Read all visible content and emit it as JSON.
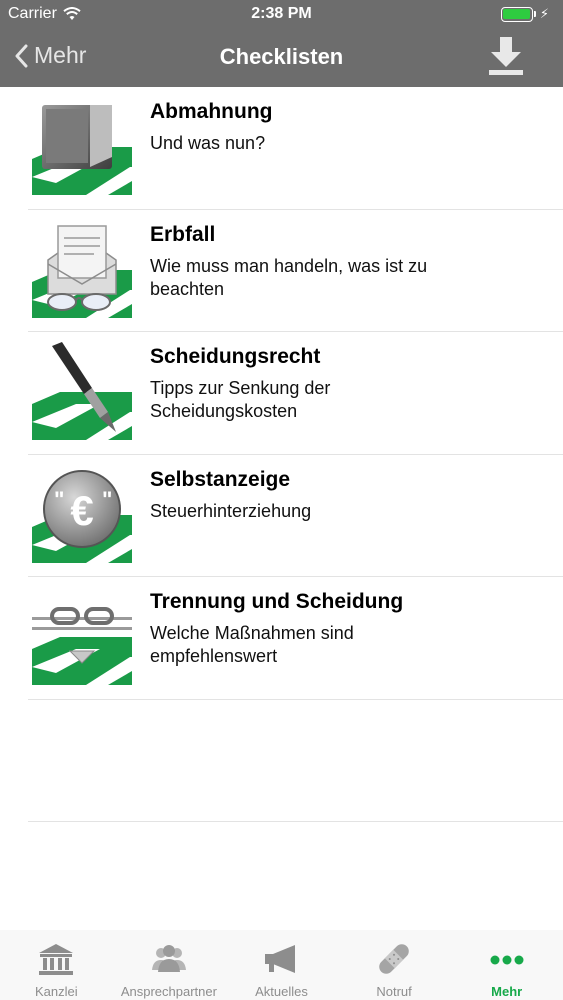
{
  "status_bar": {
    "carrier": "Carrier",
    "time": "2:38 PM",
    "battery_color": "#2ecc40"
  },
  "nav": {
    "back_label": "Mehr",
    "title": "Checklisten",
    "action_icon": "download-icon"
  },
  "checklists": [
    {
      "title": "Abmahnung",
      "subtitle": "Und was nun?",
      "icon": "wallet-icon"
    },
    {
      "title": "Erbfall",
      "subtitle": "Wie muss man handeln, was ist zu beachten",
      "icon": "letter-glasses-icon"
    },
    {
      "title": "Scheidungsrecht",
      "subtitle": "Tipps zur Senkung der Scheidungskosten",
      "icon": "fountain-pen-icon"
    },
    {
      "title": "Selbstanzeige",
      "subtitle": "Steuerhinterziehung",
      "icon": "euro-coin-icon"
    },
    {
      "title": "Trennung und Scheidung",
      "subtitle": "Welche Maßnahmen sind empfehlenswert",
      "icon": "broken-chain-icon"
    }
  ],
  "tab_bar": {
    "tabs": [
      {
        "label": "Kanzlei",
        "icon": "bank-icon"
      },
      {
        "label": "Ansprechpartner",
        "icon": "people-icon"
      },
      {
        "label": "Aktuelles",
        "icon": "megaphone-icon"
      },
      {
        "label": "Notruf",
        "icon": "bandage-icon"
      },
      {
        "label": "Mehr",
        "icon": "more-dots-icon"
      }
    ],
    "active_index": 4,
    "active_color": "#17a94a",
    "inactive_color": "#8d8d8d"
  },
  "colors": {
    "bar_background": "#6d6d6d",
    "brand_green": "#1a9b48"
  }
}
